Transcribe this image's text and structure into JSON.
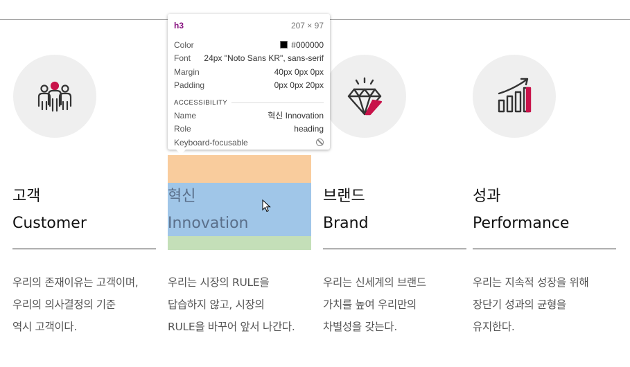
{
  "columns": [
    {
      "id": "customer",
      "icon": "people-group-icon",
      "heading": {
        "ko": "고객",
        "en": "Customer"
      },
      "description": [
        "우리의 존재이유는 고객이며,",
        "우리의 의사결정의 기준",
        "역시 고객이다."
      ]
    },
    {
      "id": "innovation",
      "icon": "lightbulb-icon",
      "heading": {
        "ko": "혁신",
        "en": "Innovation"
      },
      "description": [
        "우리는 시장의 RULE을",
        "답습하지 않고, 시장의",
        "RULE을 바꾸어 앞서 나간다."
      ]
    },
    {
      "id": "brand",
      "icon": "diamond-icon",
      "heading": {
        "ko": "브랜드",
        "en": "Brand"
      },
      "description": [
        "우리는 신세계의 브랜드",
        "가치를 높여 우리만의",
        "차별성을 갖는다."
      ]
    },
    {
      "id": "performance",
      "icon": "growth-chart-icon",
      "heading": {
        "ko": "성과",
        "en": "Performance"
      },
      "description": [
        "우리는 지속적 성장을 위해",
        "장단기 성과의 균형을",
        "유지한다."
      ]
    }
  ],
  "inspector": {
    "tag": "h3",
    "size": "207 × 97",
    "rows": [
      {
        "key": "Color",
        "value": "#000000"
      },
      {
        "key": "Font",
        "value": "24px \"Noto Sans KR\", sans-serif"
      },
      {
        "key": "Margin",
        "value": "40px 0px 0px"
      },
      {
        "key": "Padding",
        "value": "0px 0px 20px"
      }
    ],
    "section": "ACCESSIBILITY",
    "access": [
      {
        "key": "Name",
        "value": "혁신 Innovation"
      },
      {
        "key": "Role",
        "value": "heading"
      },
      {
        "key": "Keyboard-focusable",
        "value": ""
      }
    ]
  },
  "colors": {
    "accent": "#c8134a",
    "icon_dark": "#333333",
    "circle_bg": "#efefef",
    "highlight_margin": "#f6b26b",
    "highlight_content": "#6fa8dc",
    "highlight_padding": "#93c47d"
  }
}
